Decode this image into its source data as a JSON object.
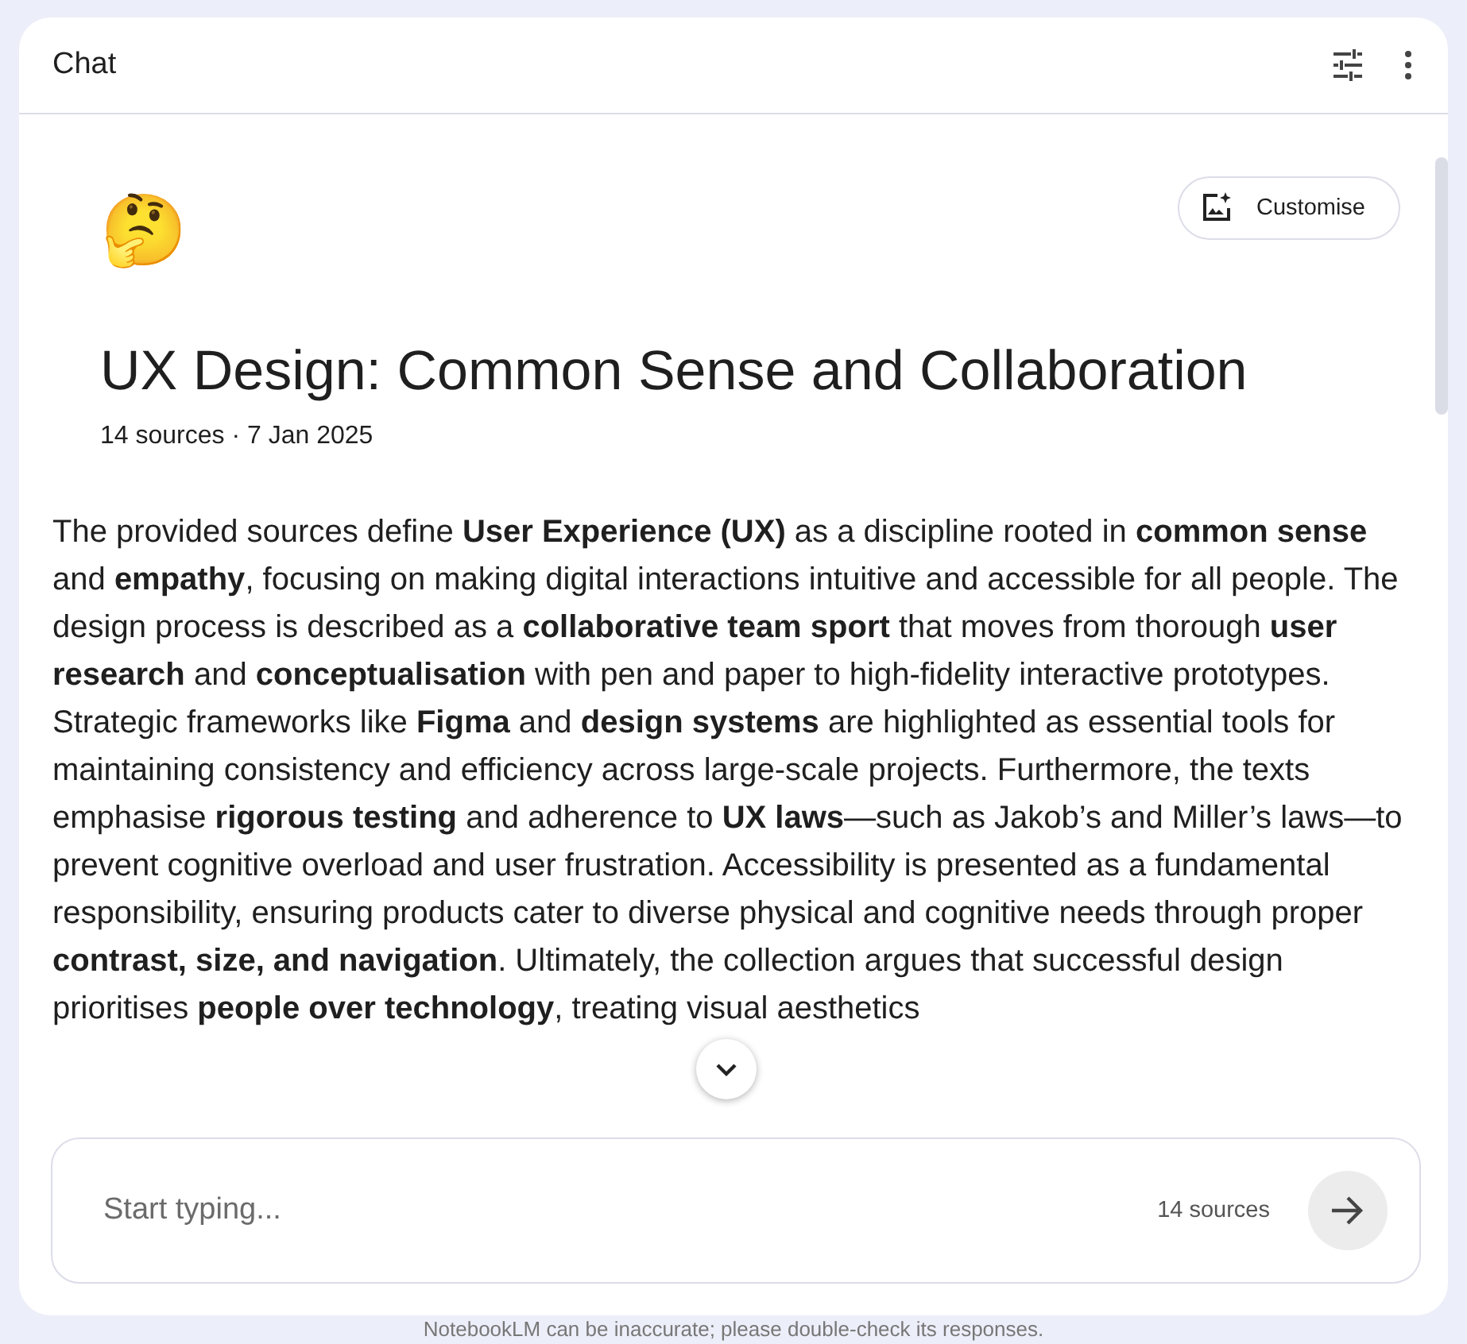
{
  "header": {
    "title": "Chat"
  },
  "notebook": {
    "emoji": "🤔",
    "customise_button": "Customise",
    "title": "UX Design: Common Sense and Collaboration",
    "meta": "14 sources · 7 Jan 2025"
  },
  "summary": "The provided sources define **User Experience (UX)** as a discipline rooted in **common sense** and **empathy**, focusing on making digital interactions intuitive and accessible for all people. The design process is described as a **collaborative team sport** that moves from thorough **user research** and **conceptualisation** with pen and paper to high-fidelity interactive prototypes. Strategic frameworks like **Figma** and **design systems** are highlighted as essential tools for maintaining consistency and efficiency across large-scale projects. Furthermore, the texts emphasise **rigorous testing** and adherence to **UX laws**—such as Jakob’s and Miller’s laws—to prevent cognitive overload and user frustration. Accessibility is presented as a fundamental responsibility, ensuring products cater to diverse physical and cognitive needs through proper **contrast, size, and navigation**. Ultimately, the collection argues that successful design prioritises **people over technology**, treating visual aesthetics",
  "composer": {
    "placeholder": "Start typing...",
    "source_count": "14 sources"
  },
  "footer": "NotebookLM can be inaccurate; please double-check its responses."
}
